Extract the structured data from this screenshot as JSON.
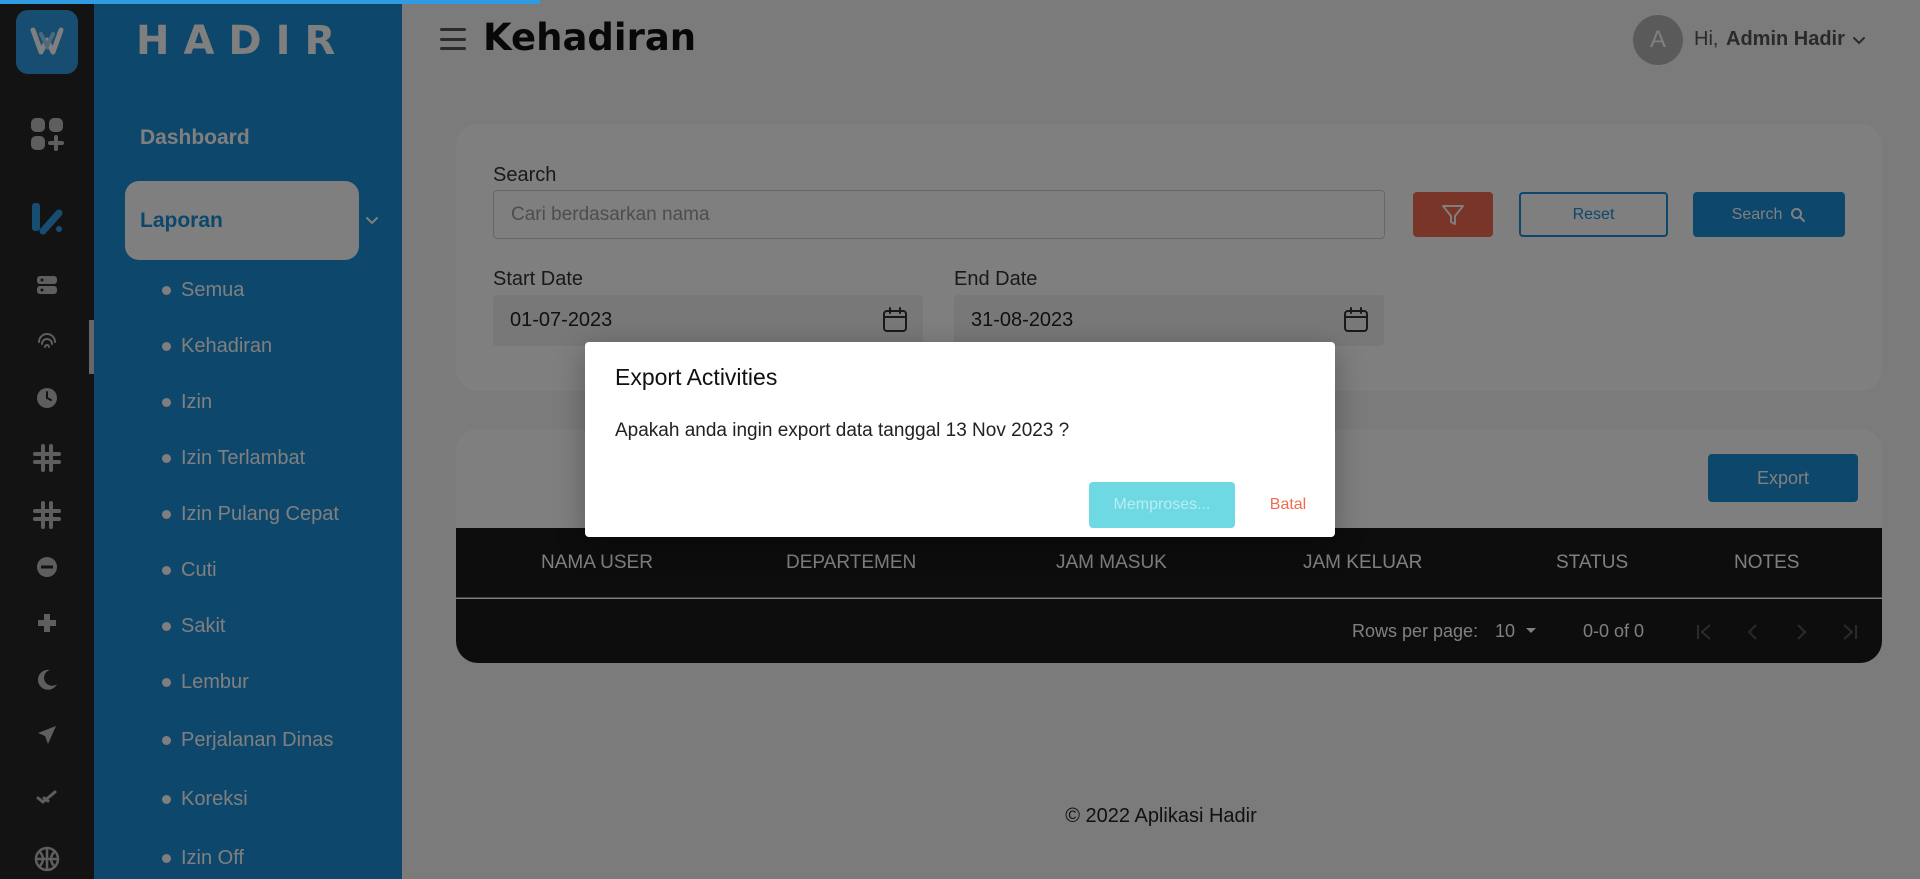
{
  "app": {
    "brand": "HADIR",
    "page_title": "Kehadiran"
  },
  "user": {
    "avatar_initial": "A",
    "greeting": "Hi,",
    "name": "Admin Hadir"
  },
  "sidebar": {
    "dashboard_label": "Dashboard",
    "active_section_label": "Laporan",
    "submenu": [
      {
        "label": "Semua"
      },
      {
        "label": "Kehadiran"
      },
      {
        "label": "Izin"
      },
      {
        "label": "Izin Terlambat"
      },
      {
        "label": "Izin Pulang Cepat"
      },
      {
        "label": "Cuti"
      },
      {
        "label": "Sakit"
      },
      {
        "label": "Lembur"
      },
      {
        "label": "Perjalanan Dinas"
      },
      {
        "label": "Koreksi"
      },
      {
        "label": "Izin Off"
      }
    ]
  },
  "rail_icons": [
    "apps-icon",
    "report-icon",
    "server-icon",
    "fingerprint-icon",
    "clock-icon",
    "hashtag-icon",
    "hashtag-icon",
    "minus-circle-icon",
    "plus-icon",
    "moon-icon",
    "plane-icon",
    "check-icon",
    "basketball-icon"
  ],
  "filters": {
    "search_label": "Search",
    "search_placeholder": "Cari berdasarkan nama",
    "reset_label": "Reset",
    "search_button_label": "Search",
    "start_date_label": "Start Date",
    "start_date_value": "01-07-2023",
    "end_date_label": "End Date",
    "end_date_value": "31-08-2023"
  },
  "table": {
    "export_label": "Export",
    "columns": [
      "NAMA USER",
      "DEPARTEMEN",
      "JAM MASUK",
      "JAM KELUAR",
      "STATUS",
      "NOTES"
    ],
    "rows_per_page_label": "Rows per page:",
    "rows_per_page_value": "10",
    "range_text": "0-0 of 0"
  },
  "footer": {
    "text": "© 2022 Aplikasi Hadir"
  },
  "dialog": {
    "title": "Export Activities",
    "message": "Apakah anda ingin export data tanggal 13 Nov 2023 ?",
    "processing_label": "Memproses...",
    "cancel_label": "Batal"
  },
  "colors": {
    "primary": "#1b8ed6",
    "accent_orange": "#f26b4f",
    "processing": "#6ed8e3",
    "rail": "#262626",
    "table_dark": "#1a1a1a"
  }
}
